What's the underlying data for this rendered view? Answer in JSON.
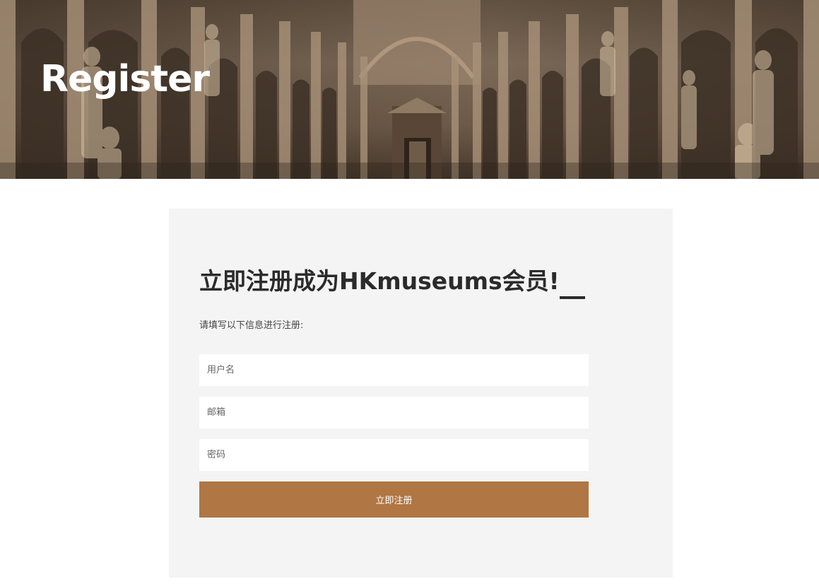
{
  "hero": {
    "title": "Register"
  },
  "form": {
    "heading": "立即注册成为HKmuseums会员!",
    "description": "请填写以下信息进行注册:",
    "username_placeholder": "用户名",
    "email_placeholder": "邮箱",
    "password_placeholder": "密码",
    "submit_label": "立即注册"
  },
  "colors": {
    "accent": "#b07643",
    "card_background": "#f4f4f4",
    "heading_text": "#2b2b2b"
  }
}
